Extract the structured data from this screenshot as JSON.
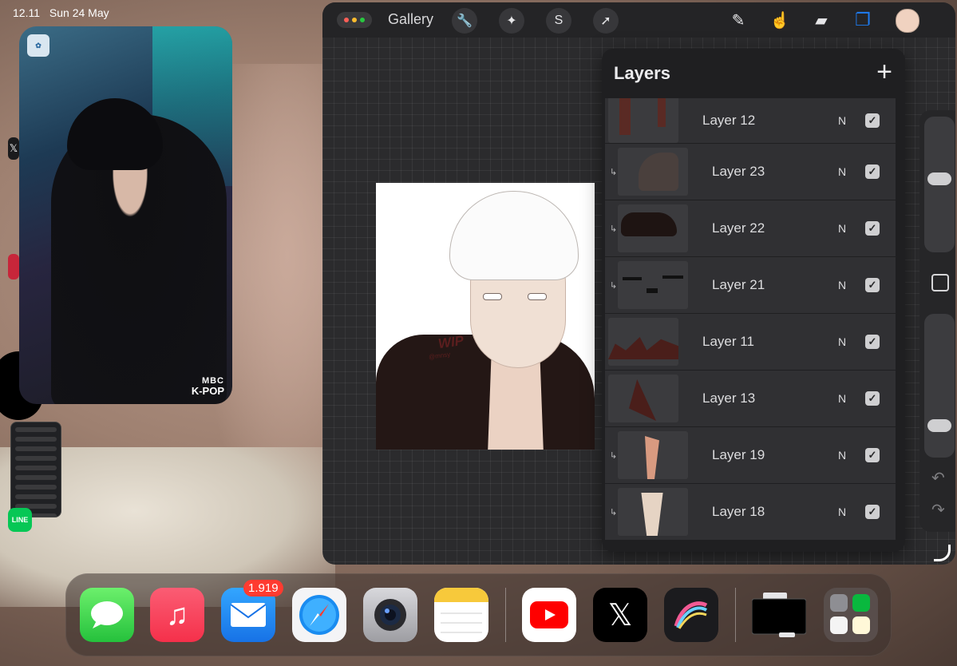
{
  "status_bar": {
    "time": "12.11",
    "date": "Sun 24 May"
  },
  "slide_over": {
    "line_label": "LINE"
  },
  "pip_video": {
    "channel_logo": "MBC",
    "channel_logo_sub": "K-POP"
  },
  "procreate": {
    "gallery_label": "Gallery",
    "toolbar_left": [
      {
        "name": "wrench-icon",
        "glyph": "🔧"
      },
      {
        "name": "magic-wand-icon",
        "glyph": "✦"
      },
      {
        "name": "selection-icon",
        "glyph": "S"
      },
      {
        "name": "transform-arrow-icon",
        "glyph": "➚"
      }
    ],
    "toolbar_right": [
      {
        "name": "brush-icon",
        "glyph": "✎"
      },
      {
        "name": "smudge-icon",
        "glyph": "☝"
      },
      {
        "name": "eraser-icon",
        "glyph": "▰"
      },
      {
        "name": "layers-icon",
        "glyph": "❐"
      }
    ],
    "color_swatch": "#f0d2c0",
    "artwork": {
      "wip_text": "WIP",
      "signature": "@mnsy"
    },
    "layers_panel": {
      "title": "Layers",
      "add_glyph": "+",
      "layers": [
        {
          "name": "Layer 12",
          "blend": "N",
          "visible": true,
          "clipped": false
        },
        {
          "name": "Layer 23",
          "blend": "N",
          "visible": true,
          "clipped": true
        },
        {
          "name": "Layer 22",
          "blend": "N",
          "visible": true,
          "clipped": true
        },
        {
          "name": "Layer 21",
          "blend": "N",
          "visible": true,
          "clipped": true
        },
        {
          "name": "Layer 11",
          "blend": "N",
          "visible": true,
          "clipped": false
        },
        {
          "name": "Layer 13",
          "blend": "N",
          "visible": true,
          "clipped": false
        },
        {
          "name": "Layer 19",
          "blend": "N",
          "visible": true,
          "clipped": true
        },
        {
          "name": "Layer 18",
          "blend": "N",
          "visible": true,
          "clipped": true
        }
      ]
    },
    "side_controls": {
      "undo_glyph": "↶",
      "redo_glyph": "↷"
    }
  },
  "dock": {
    "apps": [
      {
        "name": "Messages"
      },
      {
        "name": "Music"
      },
      {
        "name": "Mail",
        "badge": "1.919"
      },
      {
        "name": "Safari"
      },
      {
        "name": "Camera"
      },
      {
        "name": "Notes"
      },
      {
        "name": "YouTube"
      },
      {
        "name": "X"
      },
      {
        "name": "Procreate"
      },
      {
        "name": "Files"
      },
      {
        "name": "App Folder"
      }
    ]
  }
}
